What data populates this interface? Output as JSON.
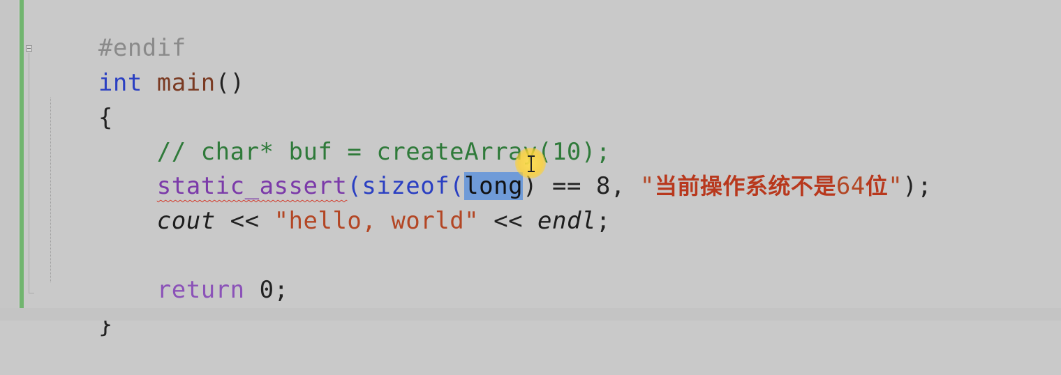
{
  "editor": {
    "lines": {
      "l1": {
        "t1": "#endif"
      },
      "l2": {
        "t1": "int",
        "t2": " main",
        "t3": "()"
      },
      "l3": {
        "t1": "{"
      },
      "l4": {
        "t1": "    // char* buf = createArray(10);"
      },
      "l5": {
        "t1": "    ",
        "t2": "static_assert",
        "t3": "(sizeof(",
        "t4": "long",
        "t5": ")",
        "t6": " == 8, ",
        "t7": "\"",
        "t8": "当前操作系统不是",
        "t9": "64",
        "t10": "位",
        "t11": "\"",
        "t12": ");"
      },
      "l6": {
        "t1": "    ",
        "t2": "cout",
        "t3": " << ",
        "t4": "\"hello, world\"",
        "t5": " << ",
        "t6": "endl",
        "t7": ";"
      },
      "l8": {
        "t1": "    ",
        "t2": "return",
        "t3": " 0;"
      },
      "l9": {
        "t1": "}"
      }
    }
  },
  "colors": {
    "background": "#c9c9c9",
    "change_bar": "#71b56f",
    "selection": "#6f9bd8",
    "keyword": "#2a3fc2",
    "comment": "#2f7a3a",
    "string": "#b34624",
    "squiggle": "#d23a2a"
  },
  "icons": [
    "fold-collapse-icon",
    "text-cursor-icon"
  ]
}
